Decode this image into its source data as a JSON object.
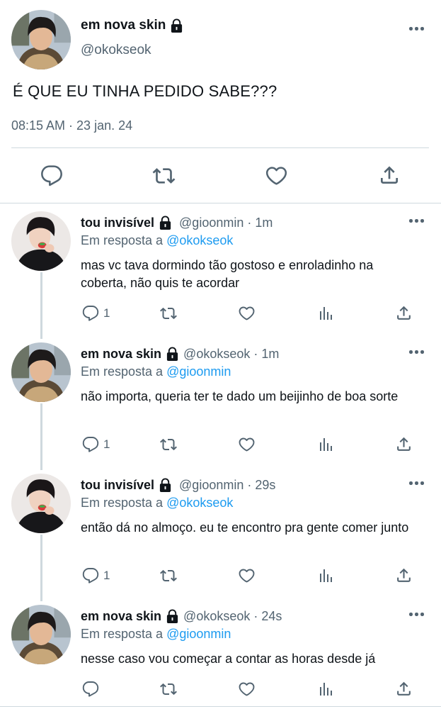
{
  "main_tweet": {
    "display_name": "em nova skin",
    "handle": "@okokseok",
    "text": "É QUE EU TINHA PEDIDO SABE???",
    "timestamp": "08:15 AM · 23 jan. 24",
    "protected": true,
    "actions": [
      "reply-icon",
      "retweet-icon",
      "like-icon",
      "share-icon"
    ]
  },
  "replies": [
    {
      "display_name": "tou invisível",
      "handle": "@gioonmin",
      "time": "1m",
      "reply_prefix": "Em resposta a",
      "reply_to": "@okokseok",
      "text": "mas vc tava dormindo tão gostoso e enroladinho na coberta, não quis te acordar",
      "reply_count": "1",
      "protected": true
    },
    {
      "display_name": "em nova skin",
      "handle": "@okokseok",
      "time": "1m",
      "reply_prefix": "Em resposta a",
      "reply_to": "@gioonmin",
      "text": "não importa, queria ter te dado um beijinho de boa sorte",
      "reply_count": "1",
      "protected": true
    },
    {
      "display_name": "tou invisível",
      "handle": "@gioonmin",
      "time": "29s",
      "reply_prefix": "Em resposta a",
      "reply_to": "@okokseok",
      "text": "então dá no almoço. eu te encontro pra gente comer junto",
      "reply_count": "1",
      "protected": true
    },
    {
      "display_name": "em nova skin",
      "handle": "@okokseok",
      "time": "24s",
      "reply_prefix": "Em resposta a",
      "reply_to": "@gioonmin",
      "text": "nesse caso vou começar a contar as horas desde já",
      "reply_count": "",
      "protected": true
    }
  ],
  "reply_actions": [
    "reply-icon",
    "retweet-icon",
    "like-icon",
    "analytics-icon",
    "share-icon"
  ],
  "colors": {
    "text": "#0f1419",
    "secondary": "#536471",
    "mention": "#1d9bf0",
    "divider": "#cfd9de"
  }
}
